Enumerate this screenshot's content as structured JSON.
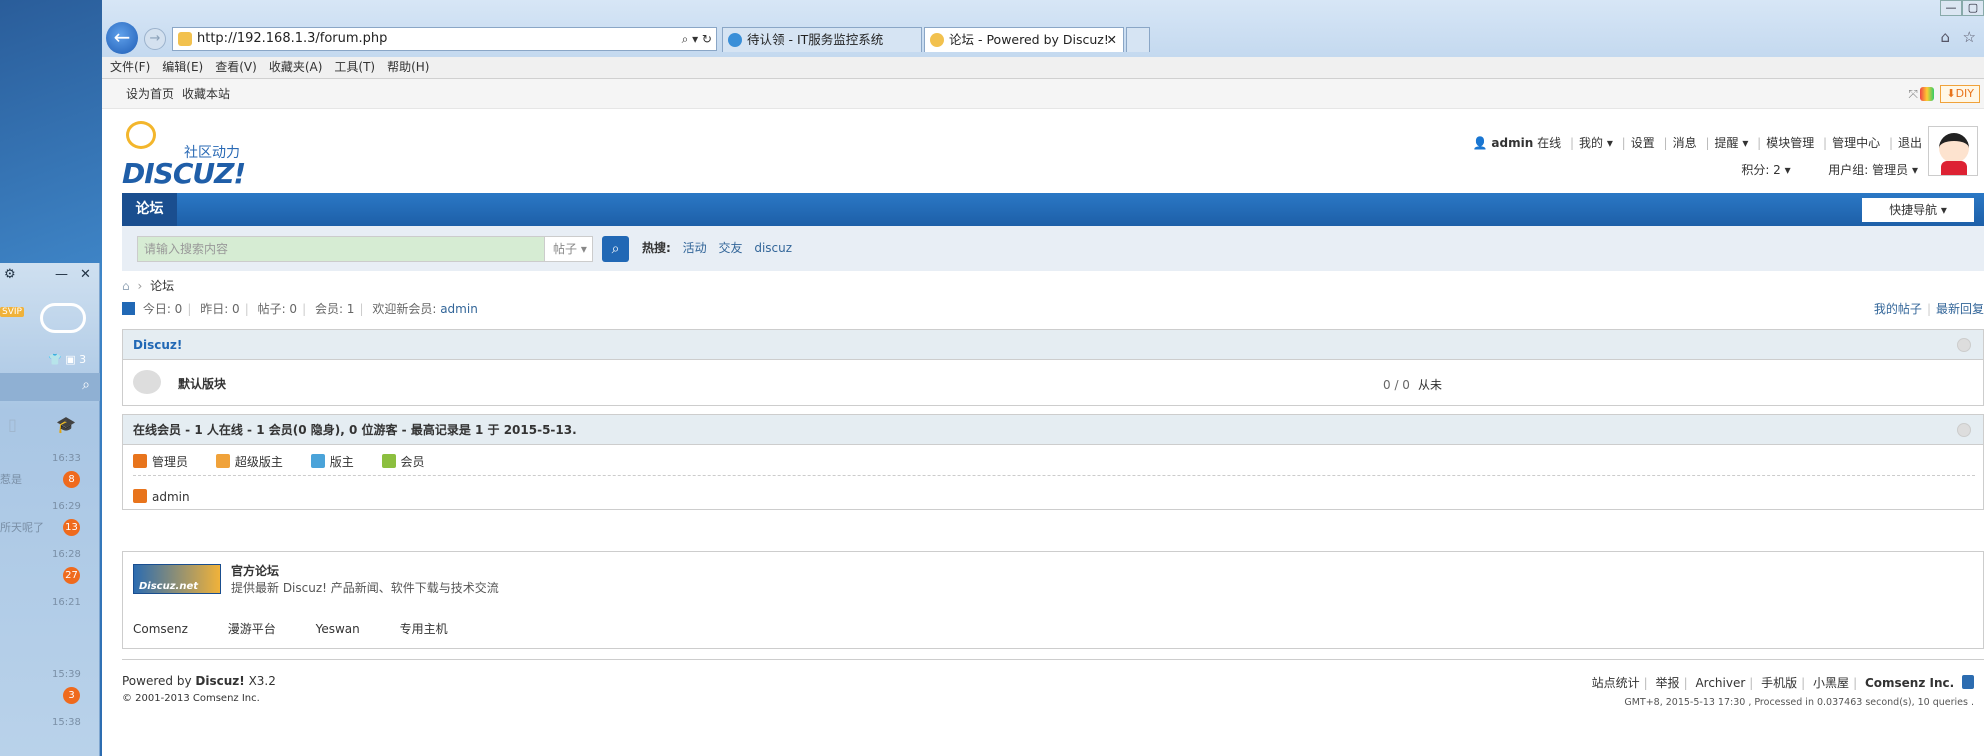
{
  "browser": {
    "address": "http://192.168.1.3/forum.php",
    "tabs": [
      {
        "label": "待认领 - IT服务监控系统"
      },
      {
        "label": "论坛 - Powered by Discuz!"
      }
    ],
    "menu": [
      "文件(F)",
      "编辑(E)",
      "查看(V)",
      "收藏夹(A)",
      "工具(T)",
      "帮助(H)"
    ]
  },
  "sidebar_qq": {
    "svip": "SVIP",
    "count": "3",
    "items": [
      {
        "time": "16:33",
        "text": "惹是",
        "badge": "8"
      },
      {
        "time": "16:29",
        "text": "所天呢了",
        "badge": "13"
      },
      {
        "time": "16:28",
        "text": "",
        "badge": "27"
      },
      {
        "time": "16:21",
        "text": "",
        "badge": ""
      },
      {
        "time": "15:39",
        "text": "",
        "badge": "3"
      },
      {
        "time": "15:38",
        "text": "",
        "badge": ""
      }
    ]
  },
  "topbar": {
    "set_home": "设为首页",
    "bookmark": "收藏本站",
    "diy": "DIY"
  },
  "header": {
    "logo_cn": "社区动力",
    "logo_en": "DISCUZ!",
    "user": "admin",
    "online": "在线",
    "links": [
      "我的",
      "设置",
      "消息",
      "提醒",
      "模块管理",
      "管理中心",
      "退出"
    ],
    "points": "积分: 2",
    "usergroup": "用户组: 管理员"
  },
  "nav": {
    "forum": "论坛",
    "quicknav": "快捷导航"
  },
  "search": {
    "placeholder": "请输入搜索内容",
    "type": "帖子",
    "hot_label": "热搜:",
    "hot": [
      "活动",
      "交友",
      "discuz"
    ]
  },
  "breadcrumb": {
    "current": "论坛"
  },
  "stats": {
    "today": "今日: 0",
    "yesterday": "昨日: 0",
    "posts": "帖子: 0",
    "members": "会员: 1",
    "welcome": "欢迎新会员:",
    "newest": "admin",
    "my_posts": "我的帖子",
    "latest": "最新回复"
  },
  "category": {
    "title": "Discuz!",
    "forum_name": "默认版块",
    "counts": "0 / 0",
    "last": "从未"
  },
  "online": {
    "title": "在线会员 - 1 人在线 - 1 会员(0 隐身), 0 位游客 - 最高记录是 1 于 2015-5-13.",
    "legend": [
      "管理员",
      "超级版主",
      "版主",
      "会员"
    ],
    "users": [
      "admin"
    ]
  },
  "links_box": {
    "title": "官方论坛",
    "desc": "提供最新 Discuz! 产品新闻、软件下载与技术交流",
    "logo_text": "Discuz.net",
    "links": [
      "Comsenz",
      "漫游平台",
      "Yeswan",
      "专用主机"
    ]
  },
  "footer": {
    "powered": "Powered by",
    "brand": "Discuz!",
    "version": "X3.2",
    "copyright": "© 2001-2013 Comsenz Inc.",
    "links": [
      "站点统计",
      "举报",
      "Archiver",
      "手机版",
      "小黑屋"
    ],
    "company": "Comsenz Inc.",
    "gmt": "GMT+8, 2015-5-13 17:30 , Processed in 0.037463 second(s), 10 queries ."
  },
  "colors": {
    "nav_blue": "#1d5fa8",
    "link": "#336699",
    "admin": "#e8741c",
    "supermod": "#f0a23a",
    "mod": "#4aa3d9",
    "member": "#8cbf3f"
  }
}
